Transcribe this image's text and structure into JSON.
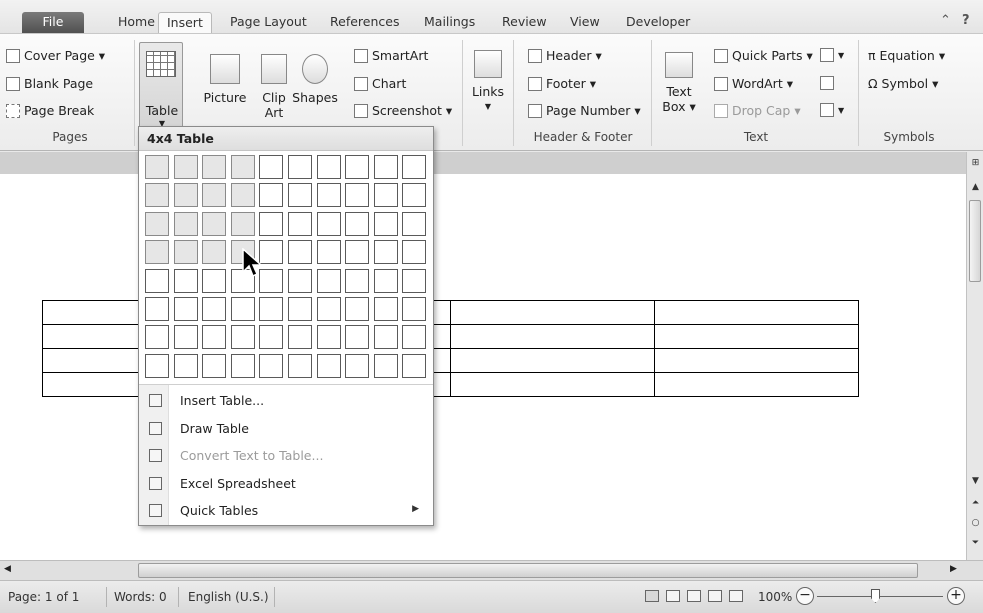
{
  "tabs": [
    {
      "label": "File"
    },
    {
      "label": "Home"
    },
    {
      "label": "Insert"
    },
    {
      "label": "Page Layout"
    },
    {
      "label": "References"
    },
    {
      "label": "Mailings"
    },
    {
      "label": "Review"
    },
    {
      "label": "View"
    },
    {
      "label": "Developer"
    }
  ],
  "ribbon": {
    "pages": {
      "items": [
        "Cover Page ▾",
        "Blank Page",
        "Page Break"
      ],
      "label": "Pages"
    },
    "tables": {
      "table_label": "Table"
    },
    "illustrations": {
      "picture": "Picture",
      "clip_art": [
        "Clip",
        "Art"
      ],
      "shapes": "Shapes",
      "smartart": "SmartArt",
      "chart": "Chart",
      "screenshot": "Screenshot ▾"
    },
    "links": {
      "label": "Links"
    },
    "header_footer": {
      "items": [
        "Header ▾",
        "Footer ▾",
        "Page Number ▾"
      ],
      "label": "Header & Footer"
    },
    "text": {
      "text_box": [
        "Text",
        "Box ▾"
      ],
      "quick_parts": "Quick Parts ▾",
      "wordart": "WordArt ▾",
      "drop_cap": "Drop Cap ▾",
      "label": "Text"
    },
    "symbols": {
      "equation": "π Equation ▾",
      "symbol": "Ω Symbol ▾",
      "label": "Symbols"
    }
  },
  "table_menu": {
    "header": "4x4 Table",
    "grid": {
      "columns": 10,
      "rows": 8,
      "selected_columns": 4,
      "selected_rows": 4
    },
    "items": [
      {
        "label": "Insert Table...",
        "icon": "insert-table-icon",
        "enabled": true
      },
      {
        "label": "Draw Table",
        "icon": "draw-table-icon",
        "enabled": true
      },
      {
        "label": "Convert Text to Table...",
        "icon": "convert-text-icon",
        "enabled": false
      },
      {
        "label": "Excel Spreadsheet",
        "icon": "excel-icon",
        "enabled": true
      },
      {
        "label": "Quick Tables",
        "icon": "quick-tables-icon",
        "enabled": true,
        "submenu": true
      }
    ]
  },
  "document": {
    "table": {
      "rows": 4,
      "columns": 4
    }
  },
  "statusbar": {
    "page": "Page: 1 of 1",
    "words": "Words: 0",
    "language": "English (U.S.)",
    "zoom": "100%",
    "zoom_level": 0.46
  }
}
